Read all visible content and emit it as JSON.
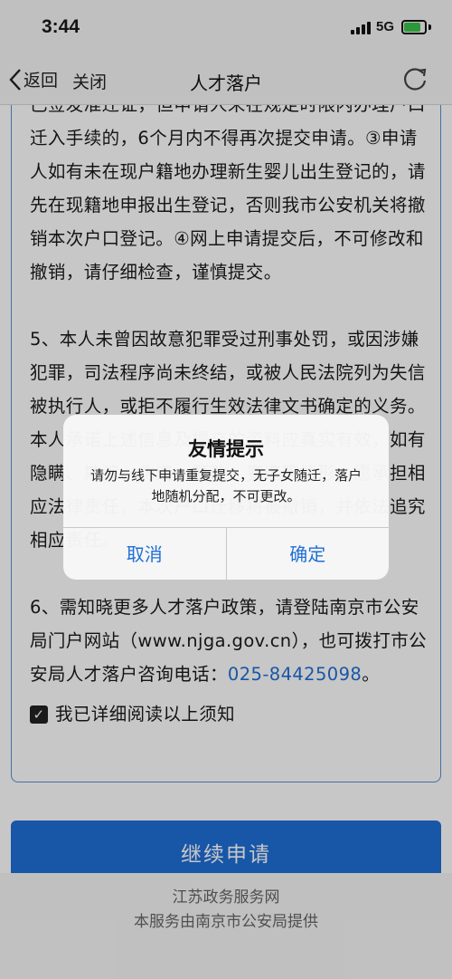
{
  "status": {
    "time": "3:44",
    "network": "5G"
  },
  "nav": {
    "back_label": "返回",
    "close_label": "关闭",
    "title": "人才落户"
  },
  "notice": {
    "para1": "已签发准迁证，但申请人未在规定时限内办理户口迁入手续的，6个月内不得再次提交申请。③申请人如有未在现户籍地办理新生婴儿出生登记的，请先在现籍地申报出生登记，否则我市公安机关将撤销本次户口登记。④网上申请提交后，不可修改和撤销，请仔细检查，谨慎提交。",
    "para2": "5、本人未曾因故意犯罪受过刑事处罚，或因涉嫌犯罪，司法程序尚未终结，或被人民法院列为失信被执行人，或拒不履行生效法律文书确定的义务。本人承诺上述信息及提交的资料应真实有效，如有隐瞒、欺骗、伪造、篡改、变造等情形，愿承担相应法律责任，本次户口迁移将被撤销，并依法追究相应责任。",
    "para3_text": "6、需知晓更多人才落户政策，请登陆南京市公安局门户网站（www.njga.gov.cn），也可拨打市公安局人才落户咨询电话：",
    "para3_phone": "025-84425098",
    "para3_end": "。",
    "agree_label": "我已详细阅读以上须知"
  },
  "continue_label": "继续申请",
  "footer": {
    "line1": "江苏政务服务网",
    "line2": "本服务由南京市公安局提供"
  },
  "dialog": {
    "title": "友情提示",
    "message": "请勿与线下申请重复提交，无子女随迁，落户地随机分配，不可更改。",
    "cancel_label": "取消",
    "confirm_label": "确定"
  },
  "battery_level": 0.8,
  "colors": {
    "accent": "#1f6fd6",
    "battery": "#3ac34a"
  }
}
